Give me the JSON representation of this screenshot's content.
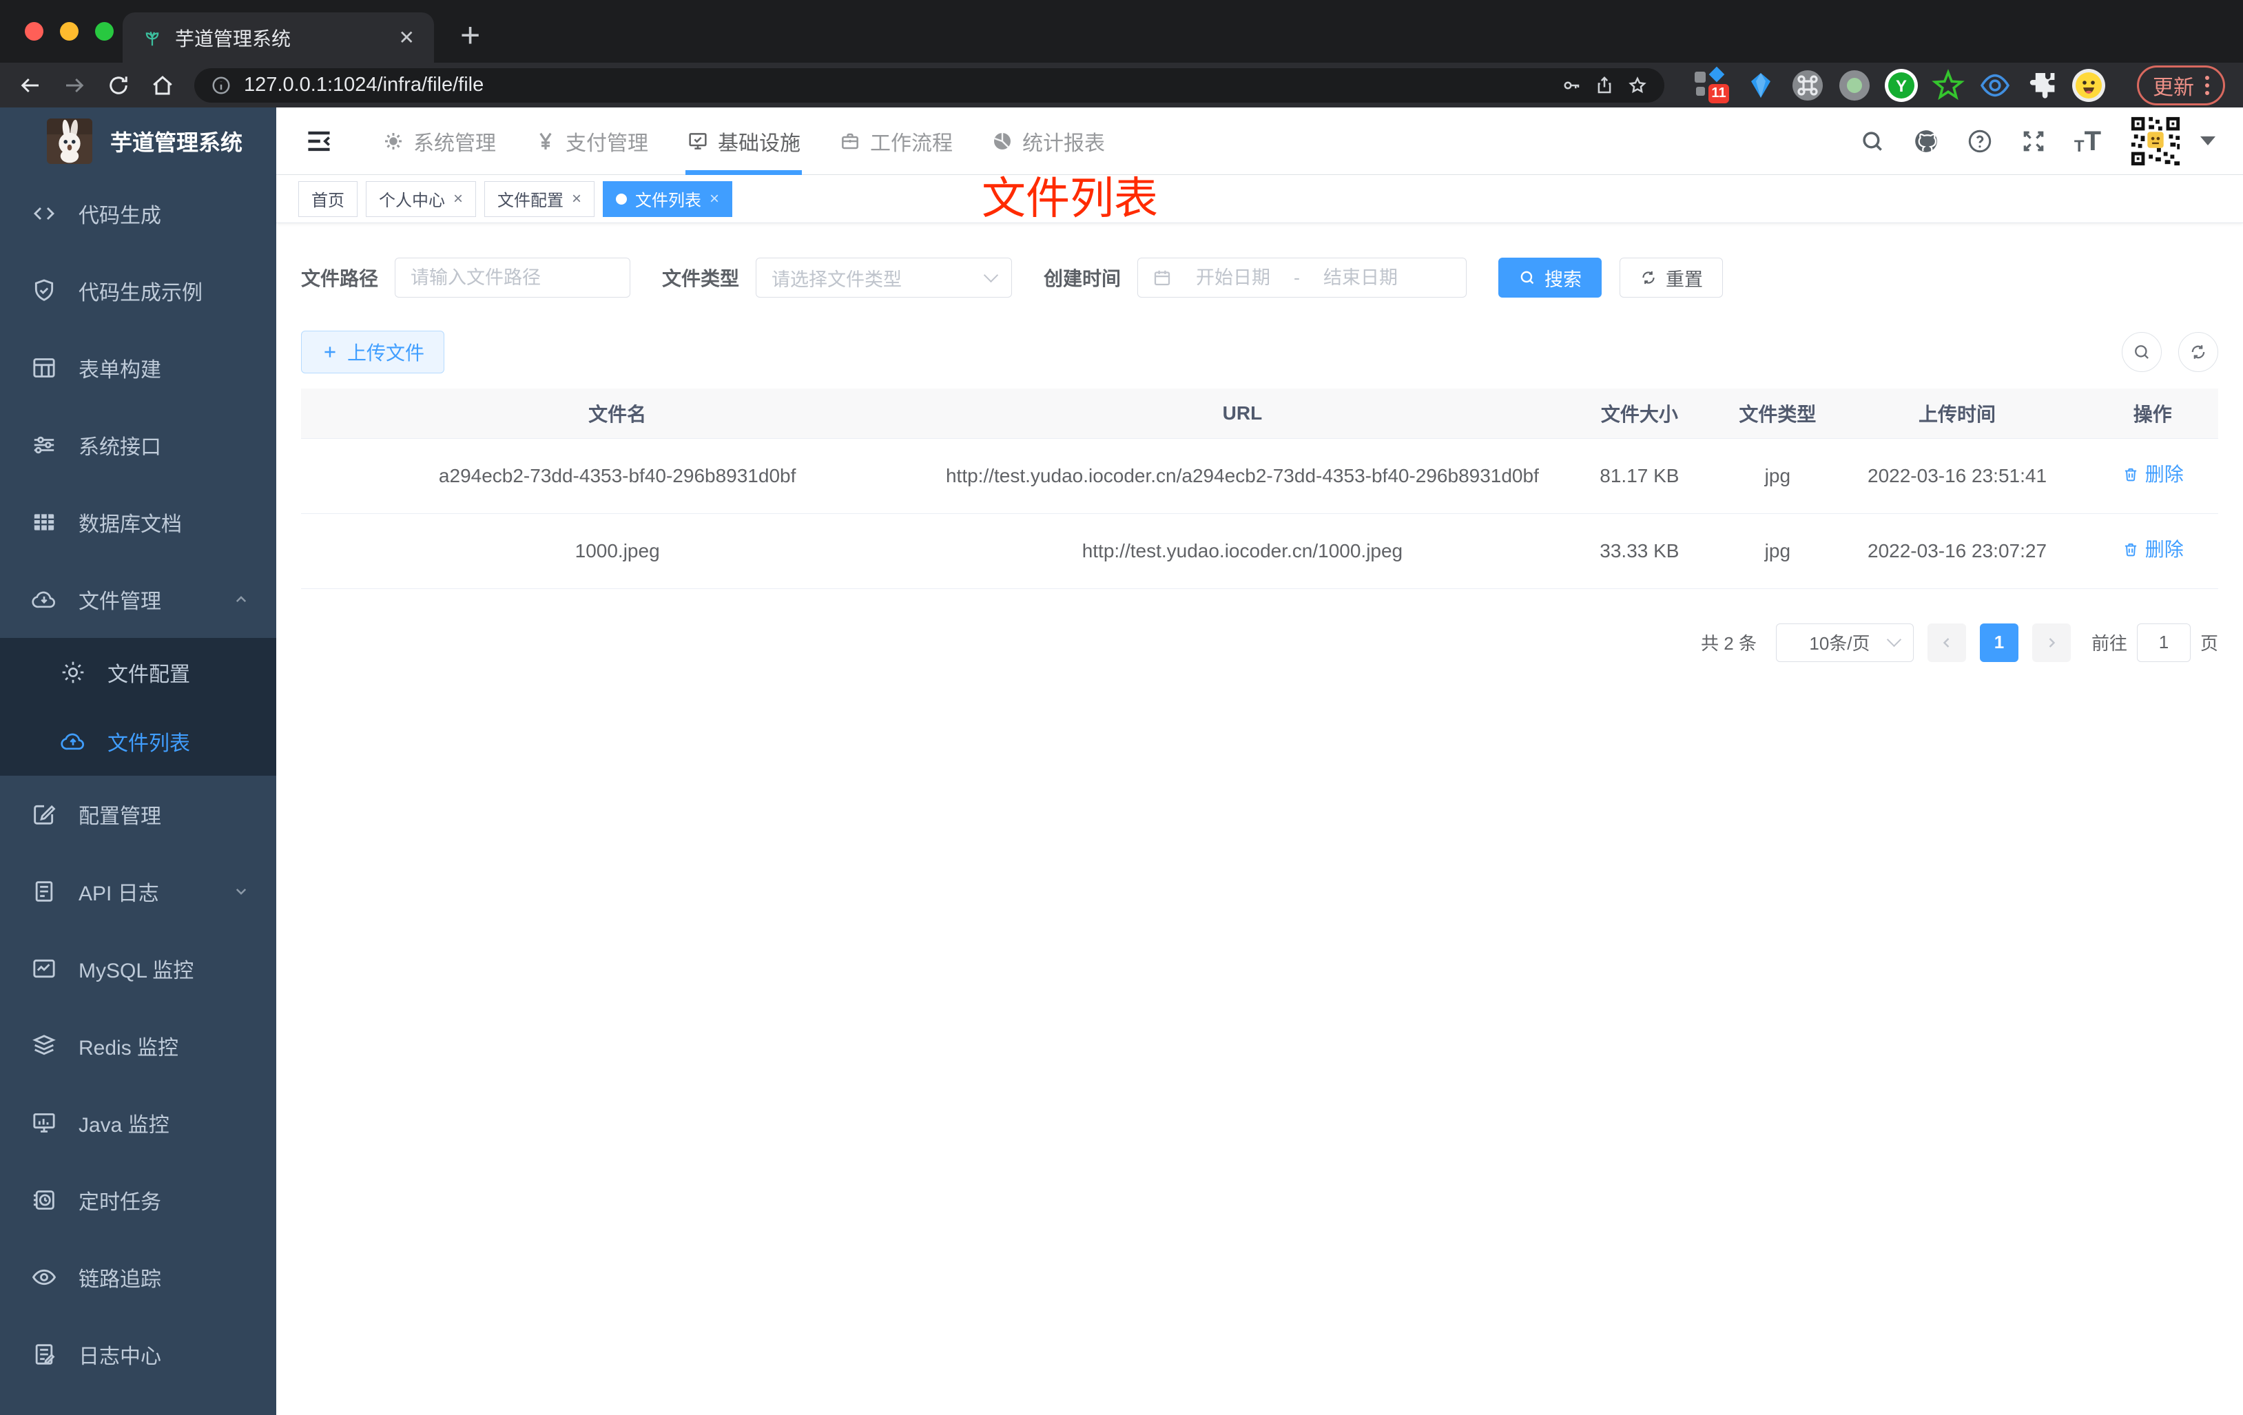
{
  "browser": {
    "tab_title": "芋道管理系统",
    "url": "127.0.0.1:1024/infra/file/file",
    "extension_badge": "11",
    "update_label": "更新"
  },
  "header": {
    "logo_title": "芋道管理系统",
    "menu": [
      {
        "label": "系统管理"
      },
      {
        "label": "支付管理"
      },
      {
        "label": "基础设施",
        "active": true
      },
      {
        "label": "工作流程"
      },
      {
        "label": "统计报表"
      }
    ]
  },
  "sidebar": {
    "items": [
      {
        "label": "代码生成"
      },
      {
        "label": "代码生成示例"
      },
      {
        "label": "表单构建"
      },
      {
        "label": "系统接口"
      },
      {
        "label": "数据库文档"
      },
      {
        "label": "文件管理",
        "expanded": true
      },
      {
        "label": "文件配置",
        "sub": true
      },
      {
        "label": "文件列表",
        "sub": true,
        "active": true
      },
      {
        "label": "配置管理"
      },
      {
        "label": "API 日志",
        "collapsed": true
      },
      {
        "label": "MySQL 监控"
      },
      {
        "label": "Redis 监控"
      },
      {
        "label": "Java 监控"
      },
      {
        "label": "定时任务"
      },
      {
        "label": "链路追踪"
      },
      {
        "label": "日志中心"
      }
    ]
  },
  "tags": {
    "items": [
      {
        "label": "首页",
        "closable": false,
        "active": false
      },
      {
        "label": "个人中心",
        "closable": true,
        "active": false
      },
      {
        "label": "文件配置",
        "closable": true,
        "active": false
      },
      {
        "label": "文件列表",
        "closable": true,
        "active": true
      }
    ],
    "close_glyph": "×"
  },
  "annotation": {
    "text": "文件列表",
    "color": "#ff2b00"
  },
  "filters": {
    "path_label": "文件路径",
    "path_placeholder": "请输入文件路径",
    "type_label": "文件类型",
    "type_placeholder": "请选择文件类型",
    "date_label": "创建时间",
    "date_start_placeholder": "开始日期",
    "date_separator": "-",
    "date_end_placeholder": "结束日期",
    "search_label": "搜索",
    "reset_label": "重置"
  },
  "toolbar": {
    "upload_label": "上传文件"
  },
  "table": {
    "headers": [
      "文件名",
      "URL",
      "文件大小",
      "文件类型",
      "上传时间",
      "操作"
    ],
    "rows": [
      {
        "name": "a294ecb2-73dd-4353-bf40-296b8931d0bf",
        "url": "http://test.yudao.iocoder.cn/a294ecb2-73dd-4353-bf40-296b8931d0bf",
        "size": "81.17 KB",
        "type": "jpg",
        "time": "2022-03-16 23:51:41",
        "action": "删除"
      },
      {
        "name": "1000.jpeg",
        "url": "http://test.yudao.iocoder.cn/1000.jpeg",
        "size": "33.33 KB",
        "type": "jpg",
        "time": "2022-03-16 23:07:27",
        "action": "删除"
      }
    ]
  },
  "pagination": {
    "total": "共 2 条",
    "page_size": "10条/页",
    "current_page": "1",
    "goto_label": "前往",
    "goto_value": "1",
    "page_unit": "页"
  },
  "colors": {
    "accent": "#409eff",
    "sidebar_bg": "#32455a",
    "submenu_bg": "#1f2d3d",
    "annotation_red": "#ff2b00",
    "table_header_bg": "#f8f8f9"
  }
}
